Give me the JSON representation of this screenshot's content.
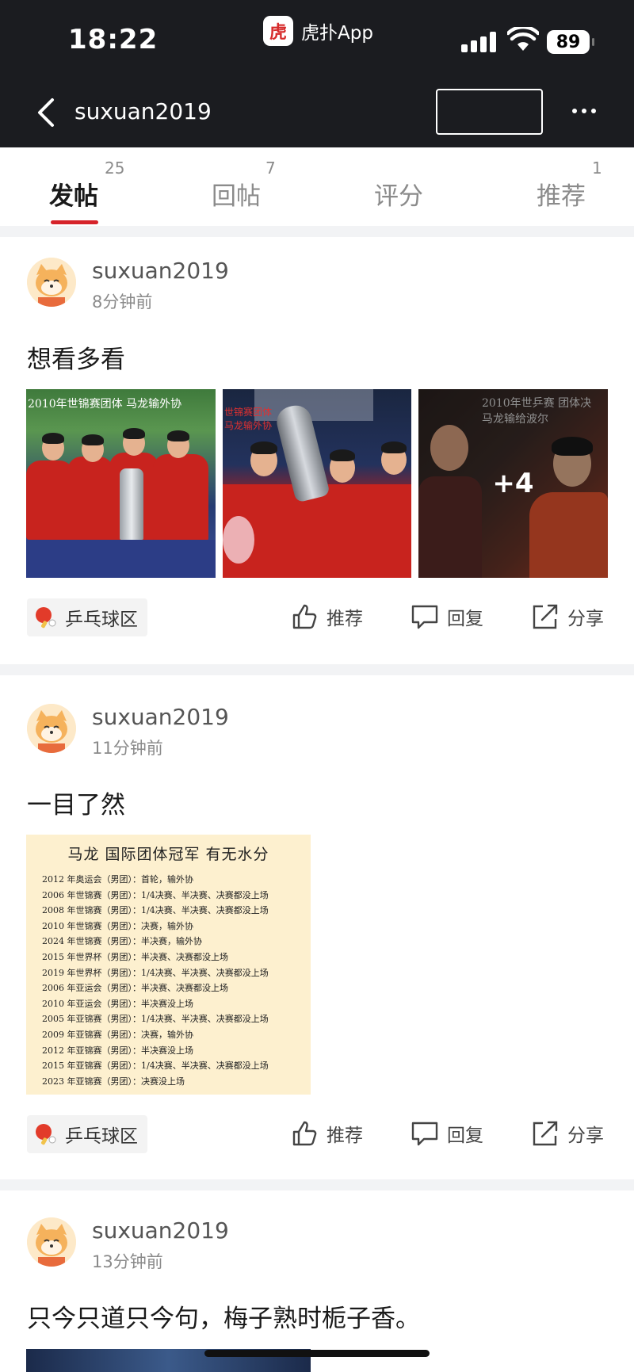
{
  "status_bar": {
    "time": "18:22",
    "app_label": "虎扑App",
    "app_logo_glyph": "虎",
    "battery": "89"
  },
  "nav": {
    "title": "suxuan2019",
    "back_icon": "chevron-left-icon",
    "more_icon": "more-horizontal-icon"
  },
  "tabs": [
    {
      "label": "发帖",
      "count": "25",
      "active": true
    },
    {
      "label": "回帖",
      "count": "7",
      "active": false
    },
    {
      "label": "评分",
      "count": "",
      "active": false
    },
    {
      "label": "推荐",
      "count": "1",
      "active": false
    }
  ],
  "actions": {
    "recommend": "推荐",
    "reply": "回复",
    "share": "分享"
  },
  "posts": [
    {
      "user": "suxuan2019",
      "time": "8分钟前",
      "title": "想看多看",
      "forum": "乒乓球区",
      "images": [
        {
          "caption": "2010年世锦赛团体  马龙输外协"
        },
        {
          "caption": "世锦赛团体 马龙输外协"
        },
        {
          "caption": "2010年世乒赛 团体决 马龙输给波尔",
          "more_count": "+4"
        }
      ]
    },
    {
      "user": "suxuan2019",
      "time": "11分钟前",
      "title": "一目了然",
      "forum": "乒乓球区",
      "table_image": {
        "title": "马龙  国际团体冠军  有无水分",
        "rows": [
          "2012 年奥运会（男团）：首轮，输外协",
          "2006 年世锦赛（男团）：1/4决赛、半决赛、决赛都没上场",
          "2008 年世锦赛（男团）：1/4决赛、半决赛、决赛都没上场",
          "2010 年世锦赛（男团）：决赛，输外协",
          "2024 年世锦赛（男团）：半决赛，输外协",
          "2015 年世界杯（男团）：半决赛、决赛都没上场",
          "2019 年世界杯（男团）：1/4决赛、半决赛、决赛都没上场",
          "2006 年亚运会（男团）：半决赛、决赛都没上场",
          "2010 年亚运会（男团）：半决赛没上场",
          "2005 年亚锦赛（男团）：1/4决赛、半决赛、决赛都没上场",
          "2009 年亚锦赛（男团）：决赛，输外协",
          "2012 年亚锦赛（男团）：半决赛没上场",
          "2015 年亚锦赛（男团）：1/4决赛、半决赛、决赛都没上场",
          "2023 年亚锦赛（男团）：决赛没上场"
        ]
      }
    },
    {
      "user": "suxuan2019",
      "time": "13分钟前",
      "title": "只今只道只今句，梅子熟时栀子香。"
    }
  ],
  "colors": {
    "topbar": "#1b1c20",
    "accent": "#d6232a",
    "divider": "#f2f3f5"
  }
}
